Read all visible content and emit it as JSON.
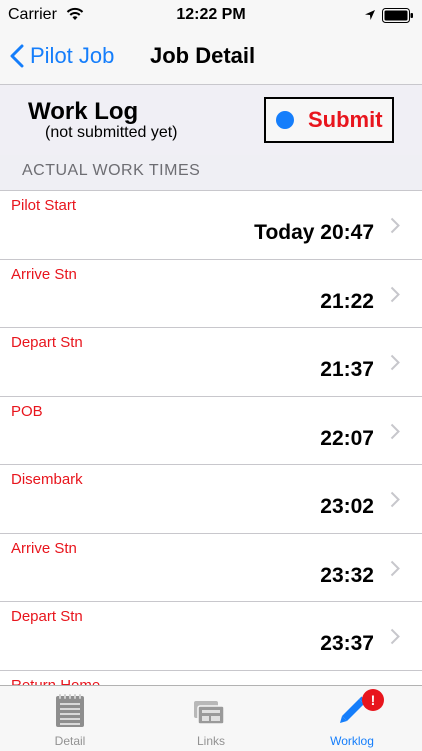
{
  "status": {
    "carrier": "Carrier",
    "time": "12:22 PM"
  },
  "nav": {
    "back_label": "Pilot Job",
    "title": "Job Detail"
  },
  "worklog": {
    "title": "Work Log",
    "subtitle": "(not submitted yet)",
    "submit_label": "Submit"
  },
  "section_header": "ACTUAL WORK TIMES",
  "rows": [
    {
      "label": "Pilot Start",
      "value": "Today 20:47"
    },
    {
      "label": "Arrive Stn",
      "value": "21:22"
    },
    {
      "label": "Depart Stn",
      "value": "21:37"
    },
    {
      "label": "POB",
      "value": "22:07"
    },
    {
      "label": "Disembark",
      "value": "23:02"
    },
    {
      "label": "Arrive Stn",
      "value": "23:32"
    },
    {
      "label": "Depart Stn",
      "value": "23:37"
    },
    {
      "label": "Return Home",
      "value": ""
    }
  ],
  "tabs": [
    {
      "label": "Detail",
      "icon": "document-icon"
    },
    {
      "label": "Links",
      "icon": "links-icon"
    },
    {
      "label": "Worklog",
      "icon": "pencil-icon"
    }
  ],
  "badge": "!",
  "colors": {
    "accent": "#157efb",
    "alert": "#e8151d"
  }
}
